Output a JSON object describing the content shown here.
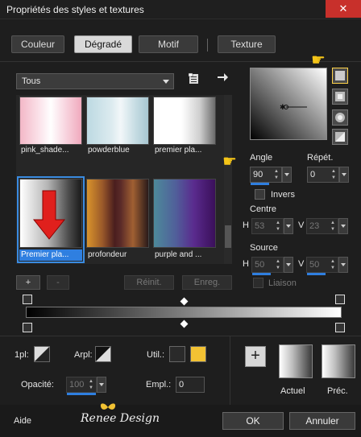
{
  "window": {
    "title": "Propriétés des styles et textures",
    "close_glyph": "✕"
  },
  "tabs": [
    {
      "label": "Couleur"
    },
    {
      "label": "Dégradé"
    },
    {
      "label": "Motif"
    },
    {
      "label": "Texture"
    }
  ],
  "gradient_select": {
    "value": "Tous"
  },
  "gallery": [
    {
      "name": "pink_shade..."
    },
    {
      "name": "powderblue"
    },
    {
      "name": "premier pla..."
    },
    {
      "name": "Premier pla..."
    },
    {
      "name": "profondeur"
    },
    {
      "name": "purple and ..."
    }
  ],
  "gallery_buttons": {
    "add": "+",
    "remove": "-",
    "reset": "Réinit.",
    "save": "Enreg."
  },
  "props": {
    "angle_label": "Angle",
    "angle": "90",
    "repeat_label": "Répét.",
    "repeat": "0",
    "invert_label": "Invers",
    "center_label": "Centre",
    "h_label": "H",
    "v_label": "V",
    "center_h": "53",
    "center_v": "23",
    "source_label": "Source",
    "source_h": "50",
    "source_v": "50",
    "link_label": "Liaison"
  },
  "bottom": {
    "pixel_label": "1pl:",
    "arpl_label": "Arpl:",
    "util_label": "Util.:",
    "opacity_label": "Opacité:",
    "opacity": "100",
    "empl_label": "Empl.:",
    "empl": "0",
    "add_glyph": "+",
    "current_label": "Actuel",
    "previous_label": "Préc."
  },
  "footer": {
    "help": "Aide",
    "watermark": "Renee Design",
    "ok": "OK",
    "cancel": "Annuler"
  },
  "colors": {
    "accent": "#3a8be0",
    "close": "#c8302b",
    "highlight": "#f5c518"
  }
}
